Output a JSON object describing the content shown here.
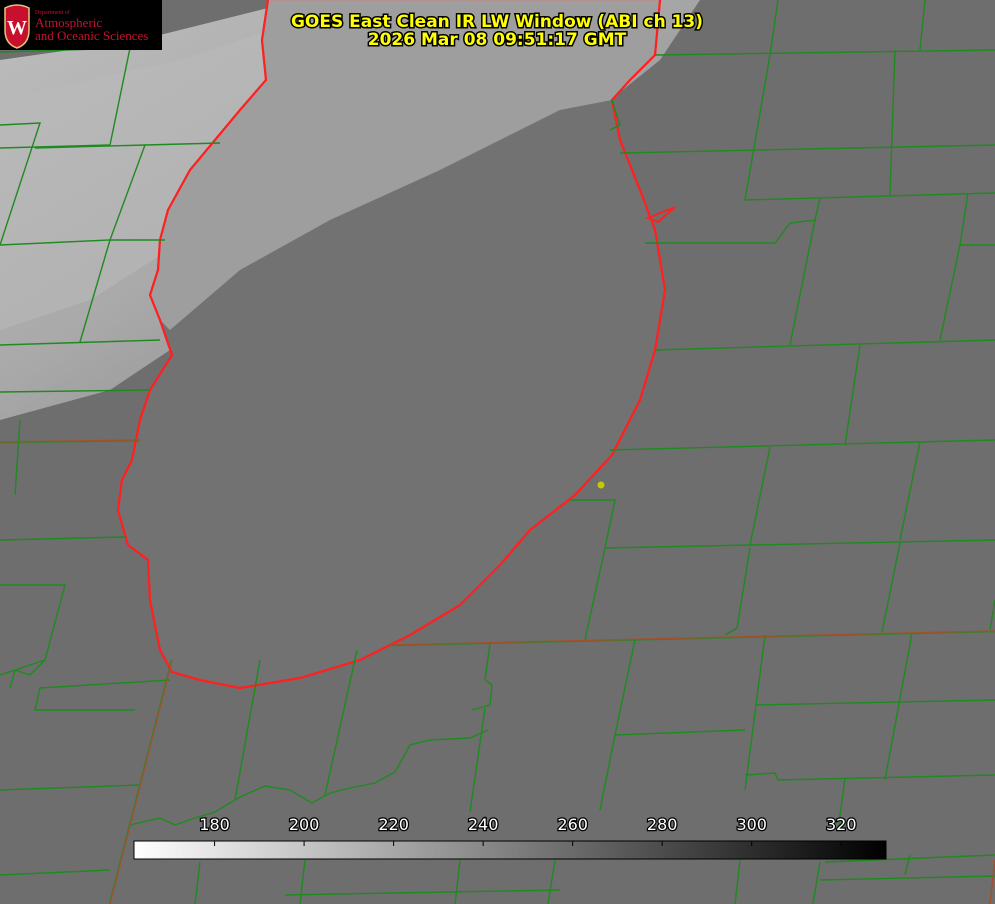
{
  "title": {
    "line1": "GOES East Clean IR LW Window (ABI ch 13)",
    "line2": "2026 Mar 08 09:51:17 GMT"
  },
  "logo": {
    "small_line": "Department of",
    "line1": "Atmospheric",
    "line2": "and Oceanic Sciences",
    "emblem_letter": "W"
  },
  "colorbar": {
    "ticks": [
      "180",
      "200",
      "220",
      "240",
      "260",
      "280",
      "300",
      "320"
    ],
    "min_value": 162,
    "max_value": 330
  },
  "colors": {
    "county_lines": "#1f8a1f",
    "state_lines": "#a0522d",
    "lakeshore": "#ff2020",
    "title": "#ffff00",
    "station_marker": "#c8c800"
  }
}
